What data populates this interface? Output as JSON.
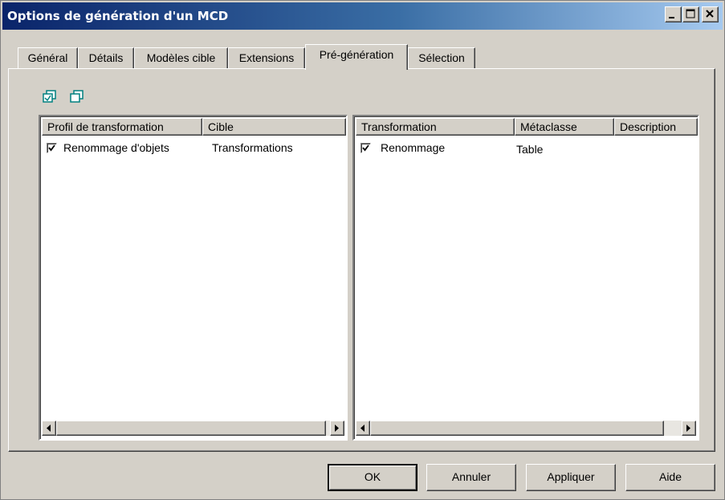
{
  "window": {
    "title": "Options de génération d'un MCD"
  },
  "tabs": [
    {
      "label": "Général"
    },
    {
      "label": "Détails"
    },
    {
      "label": "Modèles cible"
    },
    {
      "label": "Extensions"
    },
    {
      "label": "Pré-génération",
      "active": true
    },
    {
      "label": "Sélection"
    }
  ],
  "toolbar": {
    "icons": [
      "select-all-icon",
      "deselect-all-icon"
    ]
  },
  "left_list": {
    "columns": [
      "Profil de transformation",
      "Cible"
    ],
    "rows": [
      {
        "checked": true,
        "profil": "Renommage d'objets",
        "cible": "Transformations"
      }
    ]
  },
  "right_list": {
    "columns": [
      "Transformation",
      "Métaclasse",
      "Description"
    ],
    "rows": [
      {
        "checked": true,
        "transformation": "Renommage",
        "metaclasse": "Table",
        "description": ""
      }
    ]
  },
  "buttons": {
    "ok": "OK",
    "cancel": "Annuler",
    "apply": "Appliquer",
    "help": "Aide"
  },
  "colors": {
    "face": "#d4d0c8",
    "title_start": "#0a246a",
    "title_end": "#a6caf0",
    "icon_teal": "#008080"
  }
}
